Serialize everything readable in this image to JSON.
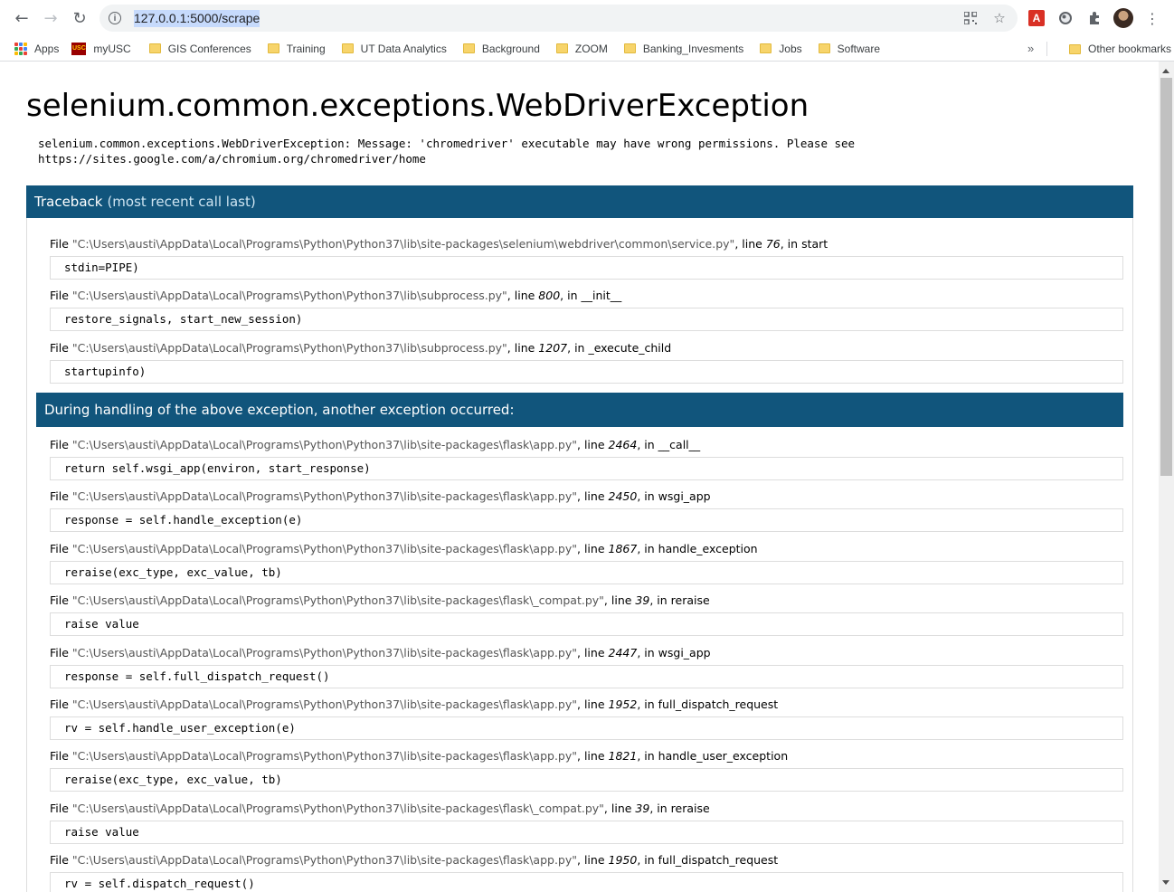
{
  "browser": {
    "url": "127.0.0.1:5000/scrape",
    "nav_back": "←",
    "nav_forward": "→",
    "nav_reload": "↻",
    "more_menu": "⋮"
  },
  "bookmarks": {
    "items": [
      {
        "label": "Apps",
        "icon": "apps-grid-icon"
      },
      {
        "label": "myUSC",
        "icon": "usc-logo-icon"
      },
      {
        "label": "GIS Conferences",
        "icon": "folder-icon"
      },
      {
        "label": "Training",
        "icon": "folder-icon"
      },
      {
        "label": "UT Data Analytics",
        "icon": "folder-icon"
      },
      {
        "label": "Background",
        "icon": "folder-icon"
      },
      {
        "label": "ZOOM",
        "icon": "folder-icon"
      },
      {
        "label": "Banking_Invesments",
        "icon": "folder-icon"
      },
      {
        "label": "Jobs",
        "icon": "folder-icon"
      },
      {
        "label": "Software",
        "icon": "folder-icon"
      }
    ],
    "overflow": "»",
    "other": "Other bookmarks",
    "usc_badge": "USC"
  },
  "page": {
    "title": "selenium.common.exceptions.WebDriverException",
    "message": "selenium.common.exceptions.WebDriverException: Message: 'chromedriver' executable may have wrong permissions. Please see\nhttps://sites.google.com/a/chromium.org/chromedriver/home",
    "traceback_label": "Traceback",
    "traceback_sub": "(most recent call last)",
    "during_handling": "During handling of the above exception, another exception occurred:",
    "frames_first": [
      {
        "file": "\"C:\\Users\\austi\\AppData\\Local\\Programs\\Python\\Python37\\lib\\site-packages\\selenium\\webdriver\\common\\service.py\"",
        "line": "76",
        "func": "start",
        "code": "stdin=PIPE)"
      },
      {
        "file": "\"C:\\Users\\austi\\AppData\\Local\\Programs\\Python\\Python37\\lib\\subprocess.py\"",
        "line": "800",
        "func": "__init__",
        "code": "restore_signals, start_new_session)"
      },
      {
        "file": "\"C:\\Users\\austi\\AppData\\Local\\Programs\\Python\\Python37\\lib\\subprocess.py\"",
        "line": "1207",
        "func": "_execute_child",
        "code": "startupinfo)"
      }
    ],
    "frames_second": [
      {
        "file": "\"C:\\Users\\austi\\AppData\\Local\\Programs\\Python\\Python37\\lib\\site-packages\\flask\\app.py\"",
        "line": "2464",
        "func": "__call__",
        "code": "return self.wsgi_app(environ, start_response)"
      },
      {
        "file": "\"C:\\Users\\austi\\AppData\\Local\\Programs\\Python\\Python37\\lib\\site-packages\\flask\\app.py\"",
        "line": "2450",
        "func": "wsgi_app",
        "code": "response = self.handle_exception(e)"
      },
      {
        "file": "\"C:\\Users\\austi\\AppData\\Local\\Programs\\Python\\Python37\\lib\\site-packages\\flask\\app.py\"",
        "line": "1867",
        "func": "handle_exception",
        "code": "reraise(exc_type, exc_value, tb)"
      },
      {
        "file": "\"C:\\Users\\austi\\AppData\\Local\\Programs\\Python\\Python37\\lib\\site-packages\\flask\\_compat.py\"",
        "line": "39",
        "func": "reraise",
        "code": "raise value"
      },
      {
        "file": "\"C:\\Users\\austi\\AppData\\Local\\Programs\\Python\\Python37\\lib\\site-packages\\flask\\app.py\"",
        "line": "2447",
        "func": "wsgi_app",
        "code": "response = self.full_dispatch_request()"
      },
      {
        "file": "\"C:\\Users\\austi\\AppData\\Local\\Programs\\Python\\Python37\\lib\\site-packages\\flask\\app.py\"",
        "line": "1952",
        "func": "full_dispatch_request",
        "code": "rv = self.handle_user_exception(e)"
      },
      {
        "file": "\"C:\\Users\\austi\\AppData\\Local\\Programs\\Python\\Python37\\lib\\site-packages\\flask\\app.py\"",
        "line": "1821",
        "func": "handle_user_exception",
        "code": "reraise(exc_type, exc_value, tb)"
      },
      {
        "file": "\"C:\\Users\\austi\\AppData\\Local\\Programs\\Python\\Python37\\lib\\site-packages\\flask\\_compat.py\"",
        "line": "39",
        "func": "reraise",
        "code": "raise value"
      },
      {
        "file": "\"C:\\Users\\austi\\AppData\\Local\\Programs\\Python\\Python37\\lib\\site-packages\\flask\\app.py\"",
        "line": "1950",
        "func": "full_dispatch_request",
        "code": "rv = self.dispatch_request()"
      }
    ],
    "file_word": "File",
    "line_word": "line",
    "in_word": "in"
  },
  "colors": {
    "header_bg": "#11557c",
    "header_sub": "#cde4f1",
    "path_gray": "#555555",
    "url_selection": "#c6dafc"
  }
}
